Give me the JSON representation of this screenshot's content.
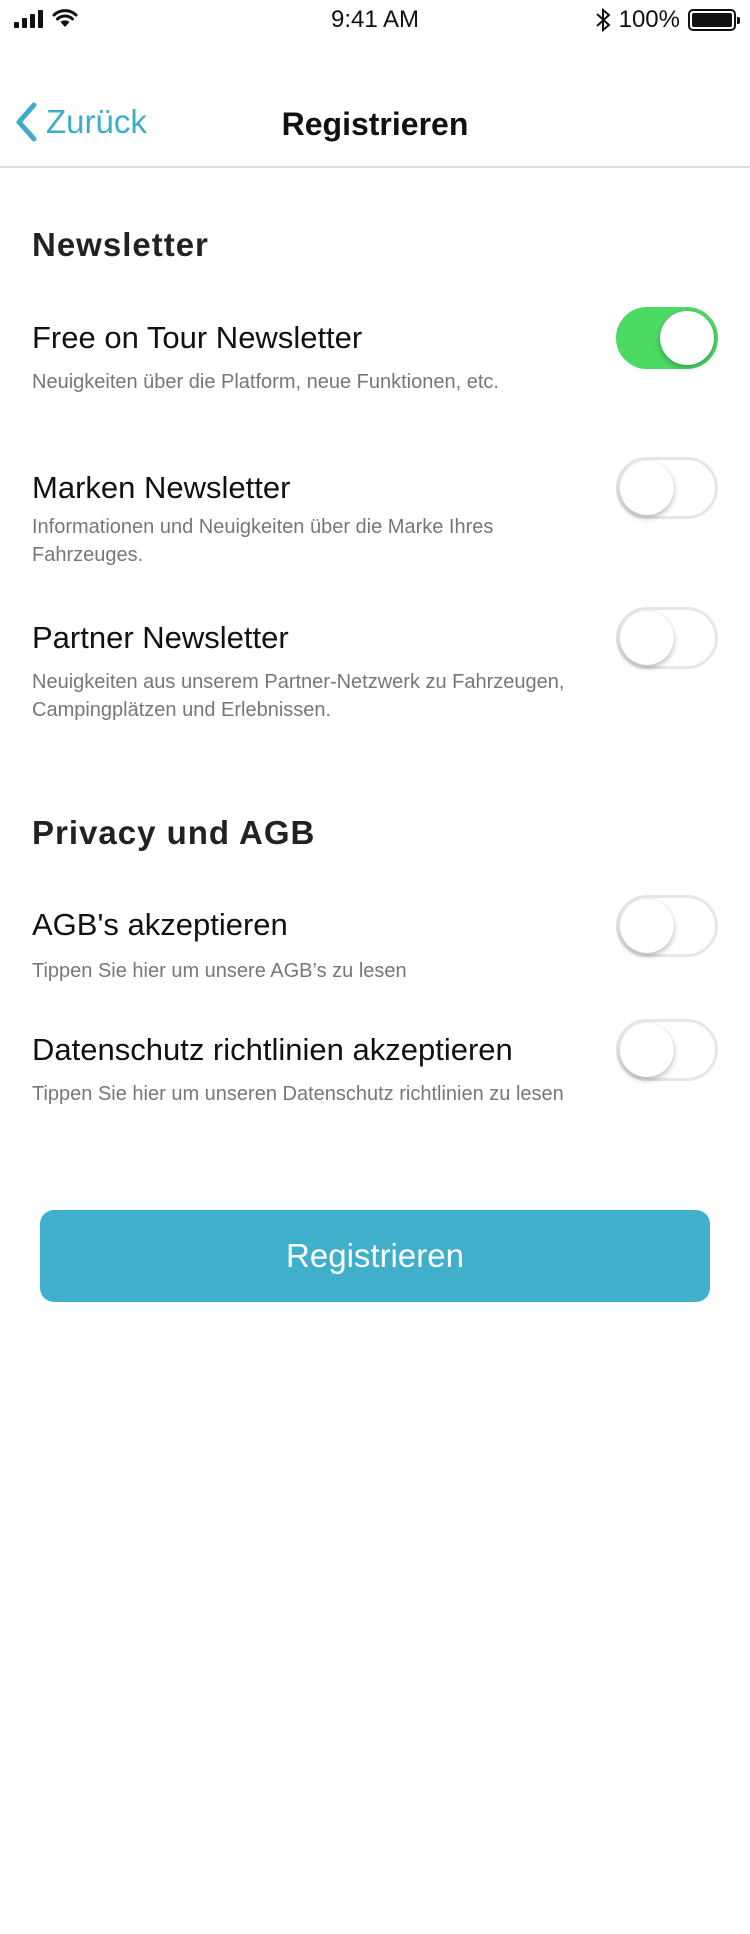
{
  "status_bar": {
    "time": "9:41 AM",
    "battery_text": "100%",
    "icons": [
      "signal-icon",
      "wifi-icon",
      "bluetooth-icon",
      "battery-icon"
    ]
  },
  "nav": {
    "back_label": "Zurück",
    "title": "Registrieren",
    "accent_color": "#3dadc9"
  },
  "newsletter": {
    "section_title": "Newsletter",
    "items": [
      {
        "title": "Free on Tour Newsletter",
        "description": "Neuigkeiten über die Platform, neue Funktionen, etc.",
        "enabled": true
      },
      {
        "title": "Marken Newsletter",
        "description": "Informationen und Neuigkeiten über die Marke Ihres Fahrzeuges.",
        "enabled": false
      },
      {
        "title": "Partner Newsletter",
        "description": "Neuigkeiten aus unserem Partner-Netzwerk zu Fahrzeugen, Campingplätzen und Erlebnissen.",
        "enabled": false
      }
    ]
  },
  "privacy": {
    "section_title": "Privacy und AGB",
    "items": [
      {
        "title": "AGB's akzeptieren",
        "description": "Tippen Sie hier um unsere AGB’s zu lesen",
        "enabled": false
      },
      {
        "title": "Datenschutz richtlinien akzeptieren",
        "description": "Tippen Sie hier um unseren Datenschutz richtlinien zu lesen",
        "enabled": false
      }
    ]
  },
  "submit": {
    "label": "Registrieren",
    "color": "#40afcc"
  },
  "colors": {
    "toggle_on": "#4cd964",
    "toggle_off_border": "#e6e6e6"
  }
}
